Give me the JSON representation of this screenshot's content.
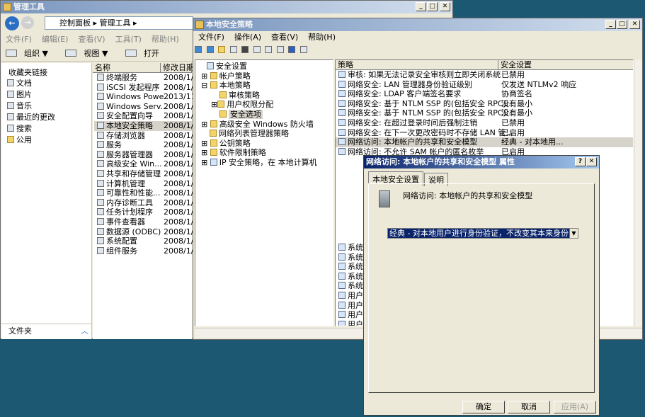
{
  "admin": {
    "title": "管理工具",
    "address": "控制面板 ▸ 管理工具 ▸",
    "menu": [
      "文件(F)",
      "编辑(E)",
      "查看(V)",
      "工具(T)",
      "帮助(H)"
    ],
    "toolbar": [
      "组织 ▼",
      "视图 ▼",
      "打开"
    ],
    "fav_title": "收藏夹链接",
    "favs": [
      "文档",
      "图片",
      "音乐",
      "最近的更改",
      "搜索",
      "公用"
    ],
    "folder_label": "文件夹",
    "col_name": "名称",
    "col_date": "修改日期",
    "items": [
      {
        "n": "终端服务",
        "d": "2008/1/1"
      },
      {
        "n": "iSCSI 发起程序",
        "d": "2008/1/1"
      },
      {
        "n": "Windows Powe...",
        "d": "2013/11/"
      },
      {
        "n": "Windows Serv...",
        "d": "2008/1/1"
      },
      {
        "n": "安全配置向导",
        "d": "2008/1/1"
      },
      {
        "n": "本地安全策略",
        "d": "2008/1/1"
      },
      {
        "n": "存储浏览器",
        "d": "2008/1/1"
      },
      {
        "n": "服务",
        "d": "2008/1/1"
      },
      {
        "n": "服务器管理器",
        "d": "2008/1/1"
      },
      {
        "n": "高级安全 Win...",
        "d": "2008/1/1"
      },
      {
        "n": "共享和存储管理",
        "d": "2008/1/1"
      },
      {
        "n": "计算机管理",
        "d": "2008/1/1"
      },
      {
        "n": "可靠性和性能...",
        "d": "2008/1/1"
      },
      {
        "n": "内存诊断工具",
        "d": "2008/1/1"
      },
      {
        "n": "任务计划程序",
        "d": "2008/1/1"
      },
      {
        "n": "事件查看器",
        "d": "2008/1/1"
      },
      {
        "n": "数据源 (ODBC)",
        "d": "2008/1/1"
      },
      {
        "n": "系统配置",
        "d": "2008/1/1"
      },
      {
        "n": "组件服务",
        "d": "2008/1/1"
      }
    ]
  },
  "secpol": {
    "title": "本地安全策略",
    "menu": [
      "文件(F)",
      "操作(A)",
      "查看(V)",
      "帮助(H)"
    ],
    "tree": [
      "安全设置",
      "帐户策略",
      "本地策略",
      "审核策略",
      "用户权限分配",
      "安全选项",
      "高级安全 Windows 防火墙",
      "网络列表管理器策略",
      "公钥策略",
      "软件限制策略",
      "IP 安全策略，在 本地计算机"
    ],
    "col_policy": "策略",
    "col_setting": "安全设置",
    "rows": [
      {
        "p": "审核: 如果无法记录安全审核则立即关闭系统",
        "s": "已禁用"
      },
      {
        "p": "网络安全: LAN 管理器身份验证级别",
        "s": "仅发送 NTLMv2 响应"
      },
      {
        "p": "网络安全: LDAP 客户端签名要求",
        "s": "协商签名"
      },
      {
        "p": "网络安全: 基于 NTLM SSP 的(包括安全 RPC)...",
        "s": "没有最小"
      },
      {
        "p": "网络安全: 基于 NTLM SSP 的(包括安全 RPC)...",
        "s": "没有最小"
      },
      {
        "p": "网络安全: 在超过登录时间后强制注销",
        "s": "已禁用"
      },
      {
        "p": "网络安全: 在下一次更改密码时不存储 LAN 管...",
        "s": "已启用"
      },
      {
        "p": "网络访问: 本地帐户的共享和安全模型",
        "s": "经典 - 对本地用..."
      },
      {
        "p": "网络访问: 不允许 SAM 帐户的匿名枚举",
        "s": "已启用"
      }
    ],
    "hidden_rows": [
      "系统",
      "系统",
      "系统",
      "系统",
      "系统",
      "用户",
      "用户",
      "用户",
      "用户"
    ]
  },
  "dialog": {
    "title": "网络访问: 本地帐户的共享和安全模型 属性",
    "tabs": [
      "本地安全设置",
      "说明"
    ],
    "heading": "网络访问: 本地帐户的共享和安全模型",
    "value": "经典 - 对本地用户进行身份验证，不改变其本来身份",
    "ok": "确定",
    "cancel": "取消",
    "apply": "应用(A)"
  }
}
